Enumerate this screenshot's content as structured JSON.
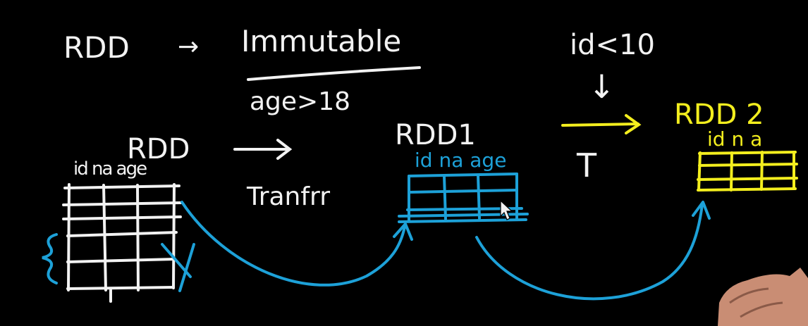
{
  "board": {
    "colors": {
      "background": "#000000",
      "chalk": "#f2f2f2",
      "blue": "#1da1d8",
      "yellow": "#f3ee1e",
      "skin": "#c98d74"
    },
    "heading": {
      "left": "RDD",
      "arrow": "→",
      "right": "Immutable"
    },
    "condition_age": "age>18",
    "condition_id": "id<10",
    "transform_label": "Tranfrr",
    "down_arrow": "↓",
    "t_label": "T",
    "tables": [
      {
        "title": "RDD",
        "columns": "id na age",
        "color": "white"
      },
      {
        "title": "RDD1",
        "columns": "id na age",
        "color": "blue"
      },
      {
        "title": "RDD 2",
        "columns": "id n a",
        "color": "yellow"
      }
    ]
  }
}
